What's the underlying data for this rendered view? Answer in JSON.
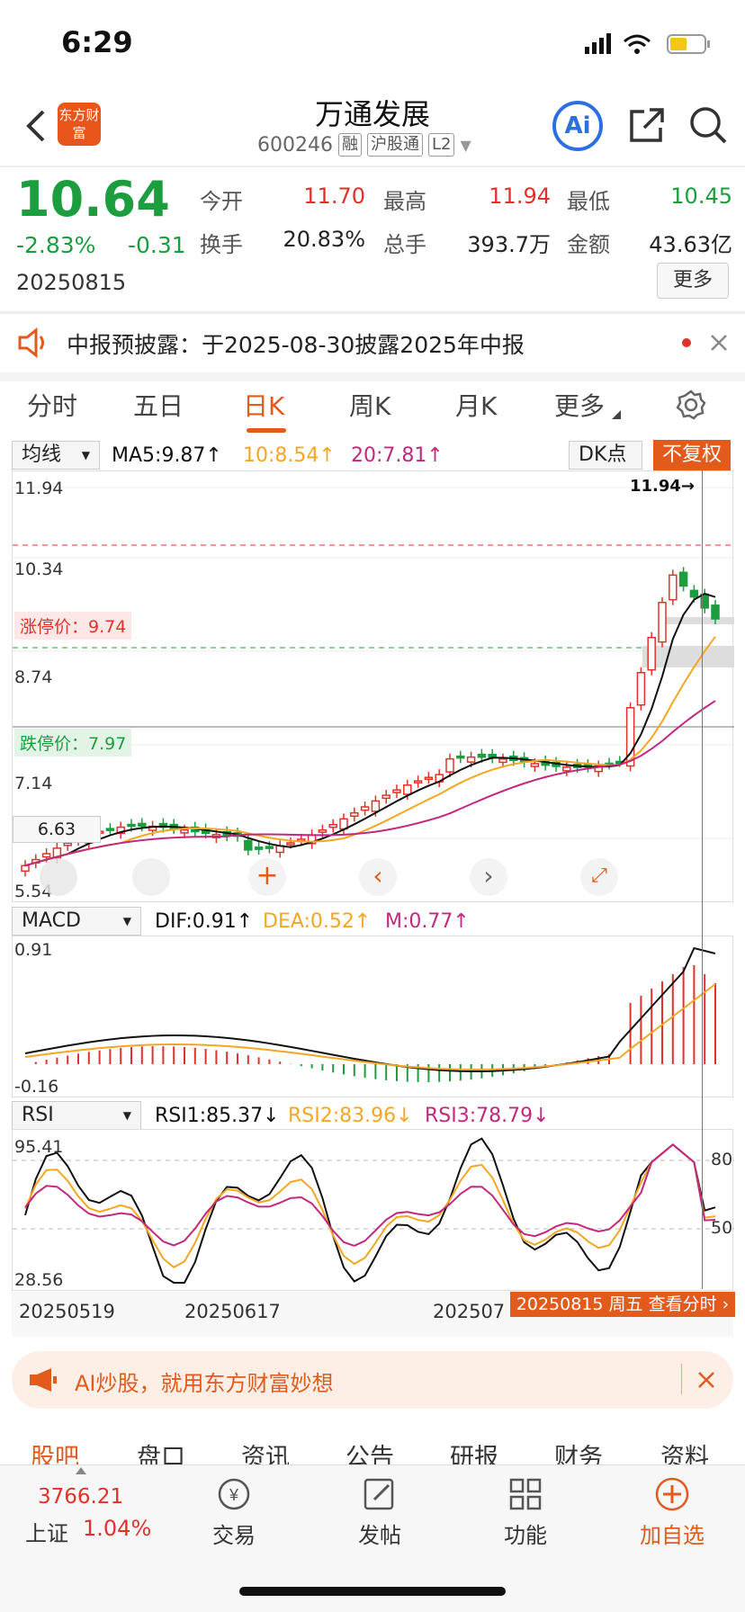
{
  "status": {
    "time": "6:29"
  },
  "header": {
    "title": "万通发展",
    "code": "600246",
    "tags": [
      "融",
      "沪股通",
      "L2"
    ],
    "app_logo_text": "东方财富",
    "ai_label": "Ai"
  },
  "quote": {
    "price": "10.64",
    "pct": "-2.83%",
    "change": "-0.31",
    "date": "20250815",
    "fields": [
      {
        "label": "今开",
        "value": "11.70",
        "color": "red"
      },
      {
        "label": "最高",
        "value": "11.94",
        "color": "red"
      },
      {
        "label": "最低",
        "value": "10.45",
        "color": "green"
      },
      {
        "label": "换手",
        "value": "20.83%",
        "color": "black"
      },
      {
        "label": "总手",
        "value": "393.7万",
        "color": "black"
      },
      {
        "label": "金额",
        "value": "43.63亿",
        "color": "black"
      }
    ],
    "more_label": "更多"
  },
  "notice": {
    "text": "中报预披露：于2025-08-30披露2025年中报"
  },
  "tabs": [
    "分时",
    "五日",
    "日K",
    "周K",
    "月K",
    "更多",
    "settings"
  ],
  "kline": {
    "indicator_select": "均线",
    "ma5": "MA5:9.87↑",
    "ma10": "10:8.54↑",
    "ma20": "20:7.81↑",
    "dk_label": "DK点",
    "fq_label": "不复权",
    "y_labels": [
      "11.94",
      "10.34",
      "8.74",
      "7.14",
      "5.54"
    ],
    "high_marker": "11.94→",
    "limit_up": "涨停价：9.74",
    "limit_down": "跌停价：7.97",
    "crosshair_price": "6.63"
  },
  "macd": {
    "select": "MACD",
    "dif": "DIF:0.91↑",
    "dea": "DEA:0.52↑",
    "m": "M:0.77↑",
    "y_top": "0.91",
    "y_bottom": "-0.16"
  },
  "rsi": {
    "select": "RSI",
    "rsi1": "RSI1:85.37↓",
    "rsi2": "RSI2:83.96↓",
    "rsi3": "RSI3:78.79↓",
    "y_top": "95.41",
    "y_bottom": "28.56",
    "r80": "80",
    "r50": "50"
  },
  "xaxis": {
    "d1": "20250519",
    "d2": "20250617",
    "d3": "202507",
    "tooltip": "20250815 周五 查看分时"
  },
  "ad": {
    "text": "AI炒股，就用东方财富妙想"
  },
  "bottom_tabs": [
    "股吧",
    "盘口",
    "资讯",
    "公告",
    "研报",
    "财务",
    "资料"
  ],
  "footer": {
    "index_value": "3766.21",
    "index_name": "上证",
    "index_pct": "1.04%",
    "items": [
      "交易",
      "发帖",
      "功能",
      "加自选"
    ]
  },
  "colors": {
    "up": "#e0322b",
    "down": "#1c9e3f",
    "accent": "#e25a1c",
    "ma5": "#111111",
    "ma10": "#f5a623",
    "ma20": "#c2287d"
  },
  "chart_data": [
    {
      "type": "candlestick",
      "title": "日K",
      "series": [
        {
          "name": "MA5",
          "last": 9.87
        },
        {
          "name": "10",
          "last": 8.54
        },
        {
          "name": "20",
          "last": 7.81
        }
      ],
      "ylim": [
        5.54,
        11.94
      ],
      "annotations": [
        "涨停价 9.74",
        "跌停价 7.97",
        "11.94"
      ]
    },
    {
      "type": "bar",
      "title": "MACD",
      "series": [
        {
          "name": "DIF",
          "last": 0.91
        },
        {
          "name": "DEA",
          "last": 0.52
        },
        {
          "name": "M",
          "last": 0.77
        }
      ],
      "ylim": [
        -0.16,
        0.91
      ]
    },
    {
      "type": "line",
      "title": "RSI",
      "series": [
        {
          "name": "RSI1",
          "last": 85.37
        },
        {
          "name": "RSI2",
          "last": 83.96
        },
        {
          "name": "RSI3",
          "last": 78.79
        }
      ],
      "ylim": [
        28.56,
        95.41
      ]
    }
  ]
}
